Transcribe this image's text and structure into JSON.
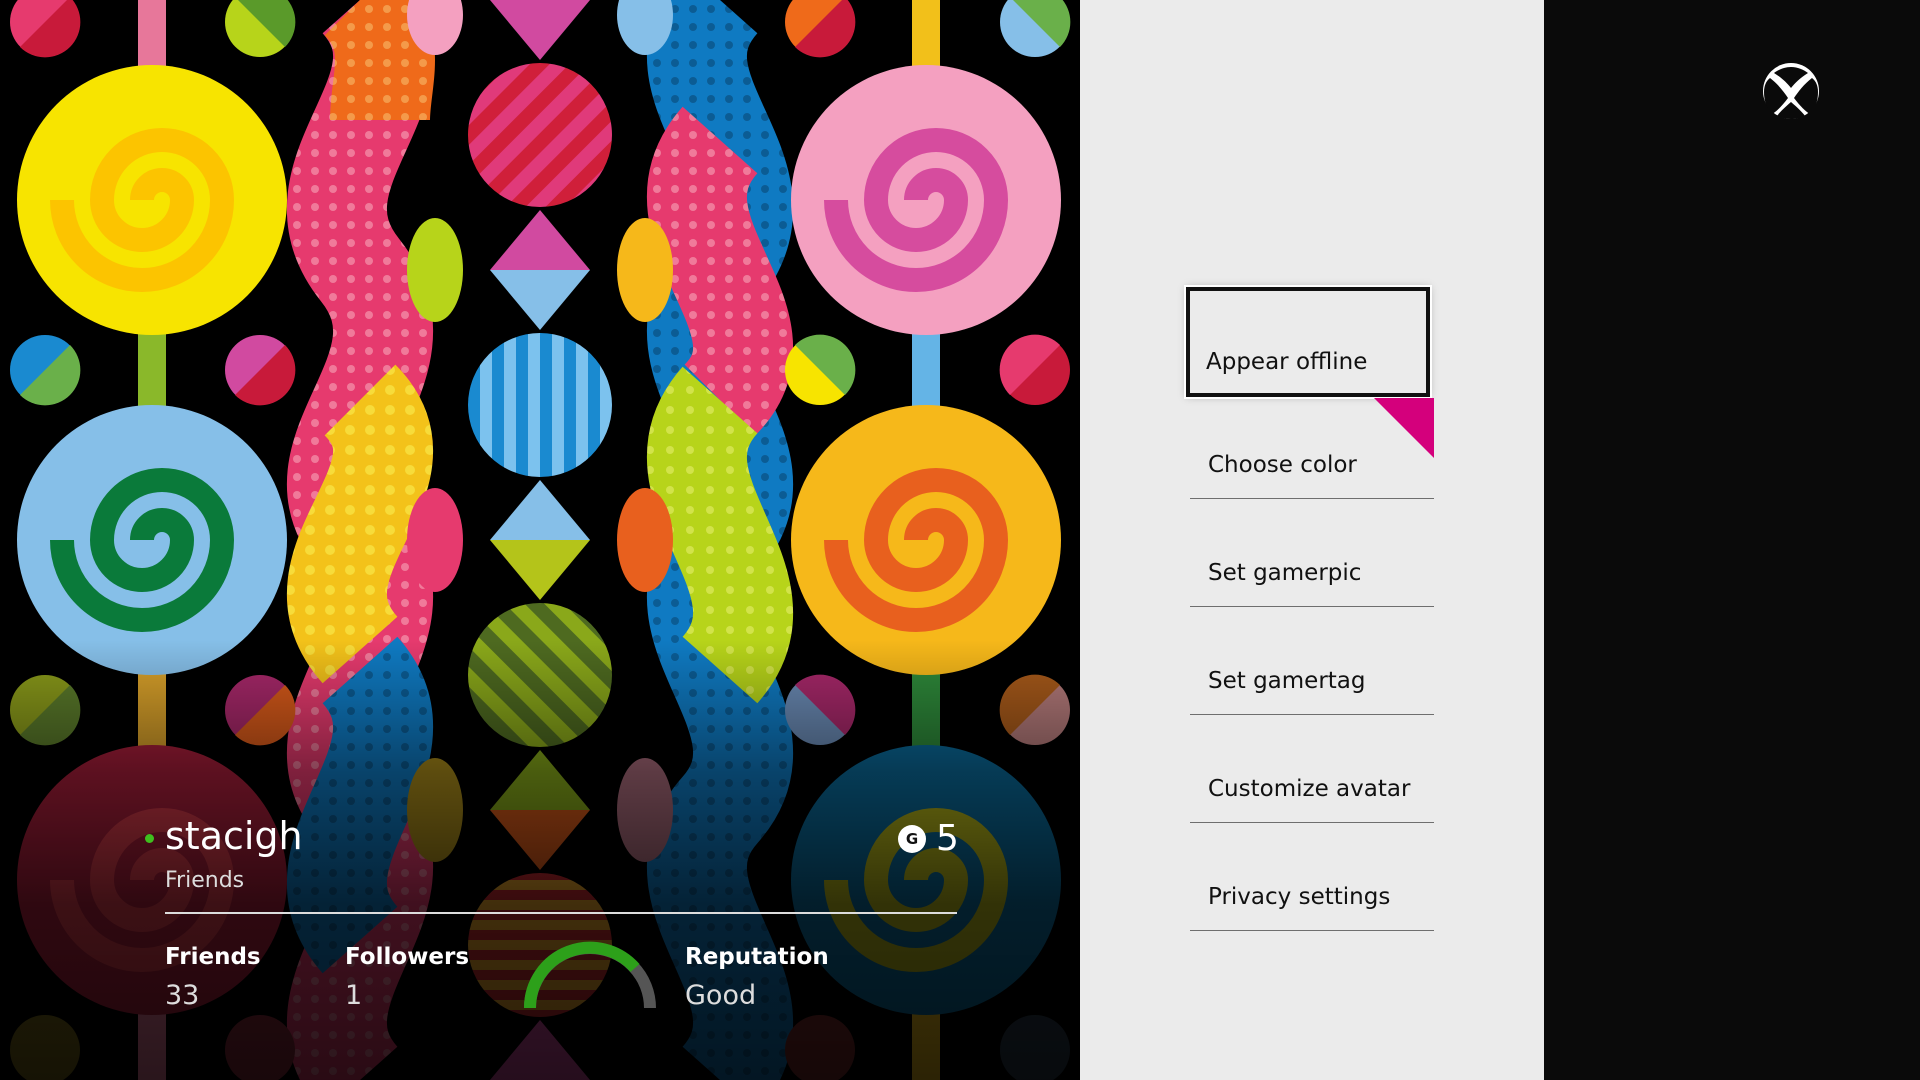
{
  "profile": {
    "gamertag": "stacigh",
    "relationship": "Friends",
    "gamerscore": "5",
    "gamerscore_icon_letter": "G",
    "presence_color": "#3fbf1e",
    "stats": {
      "friends_label": "Friends",
      "friends_value": "33",
      "followers_label": "Followers",
      "followers_value": "1",
      "reputation_label": "Reputation",
      "reputation_value": "Good",
      "reputation_color": "#2da01a"
    }
  },
  "menu": {
    "accent_color": "#d4007c",
    "items": [
      {
        "label": "Appear offline",
        "focused": true
      },
      {
        "label": "Choose color"
      },
      {
        "label": "Set gamerpic"
      },
      {
        "label": "Set gamertag"
      },
      {
        "label": "Customize avatar"
      },
      {
        "label": "Privacy settings"
      }
    ]
  },
  "brand": {
    "logo": "xbox-icon"
  }
}
